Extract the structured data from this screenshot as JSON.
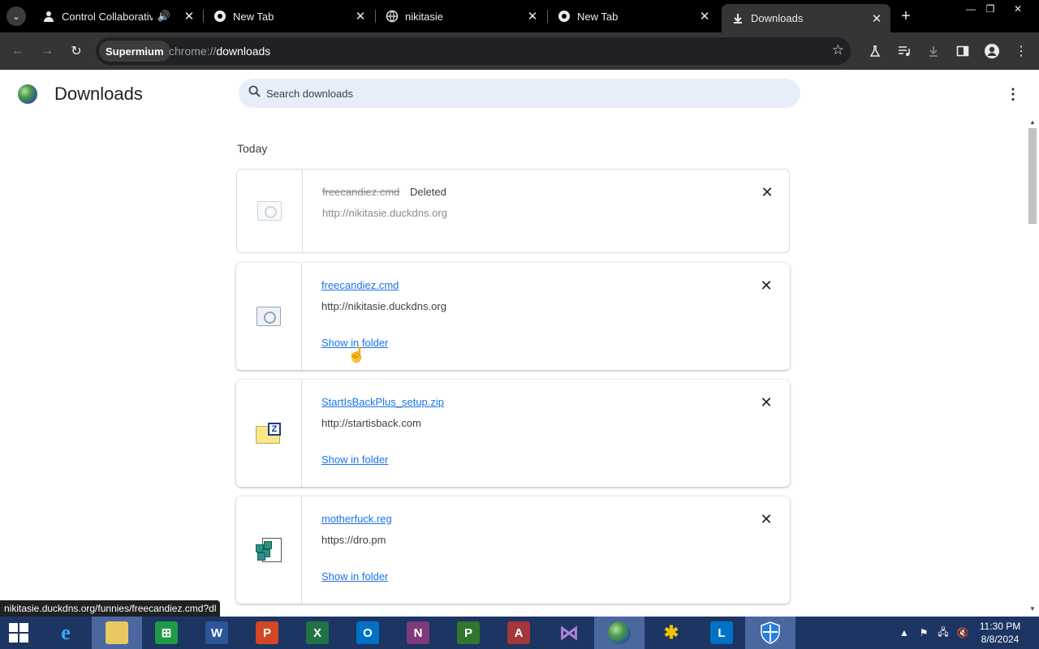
{
  "tabs": [
    {
      "title": "Control Collaborative \\",
      "icon": "collab-icon",
      "audio": true
    },
    {
      "title": "New Tab",
      "icon": "chrome-icon"
    },
    {
      "title": "nikitasie",
      "icon": "globe-icon"
    },
    {
      "title": "New Tab",
      "icon": "chrome-icon"
    },
    {
      "title": "Downloads",
      "icon": "download-icon",
      "active": true
    }
  ],
  "toolbar": {
    "chip": "Supermium",
    "url_scheme": "chrome://",
    "url_host": "downloads"
  },
  "page": {
    "title": "Downloads",
    "search_placeholder": "Search downloads",
    "section": "Today"
  },
  "downloads": [
    {
      "filename": "freecandiez.cmd",
      "status": "Deleted",
      "source": "http://nikitasie.duckdns.org",
      "icon": "cmd-file-icon",
      "deleted": true
    },
    {
      "filename": "freecandiez.cmd",
      "source": "http://nikitasie.duckdns.org",
      "action": "Show in folder",
      "icon": "cmd-file-icon"
    },
    {
      "filename": "StartIsBackPlus_setup.zip",
      "source": "http://startisback.com",
      "action": "Show in folder",
      "icon": "zip-file-icon"
    },
    {
      "filename": "motherfuck.reg",
      "source": "https://dro.pm",
      "action": "Show in folder",
      "icon": "reg-file-icon"
    }
  ],
  "status_bar": "nikitasie.duckdns.org/funnies/freecandiez.cmd?dl",
  "taskbar": {
    "apps": [
      "start",
      "internet-explorer",
      "file-explorer",
      "excel-green",
      "word",
      "powerpoint",
      "excel",
      "outlook",
      "onenote",
      "project",
      "access",
      "visual-studio",
      "supermium",
      "bee-app",
      "lync",
      "defender"
    ],
    "time": "11:30 PM",
    "date": "8/8/2024"
  },
  "colors": {
    "accent_link": "#1a73e8",
    "taskbar": "#1c3563",
    "tab_strip": "#000000",
    "toolbar": "#353535"
  }
}
